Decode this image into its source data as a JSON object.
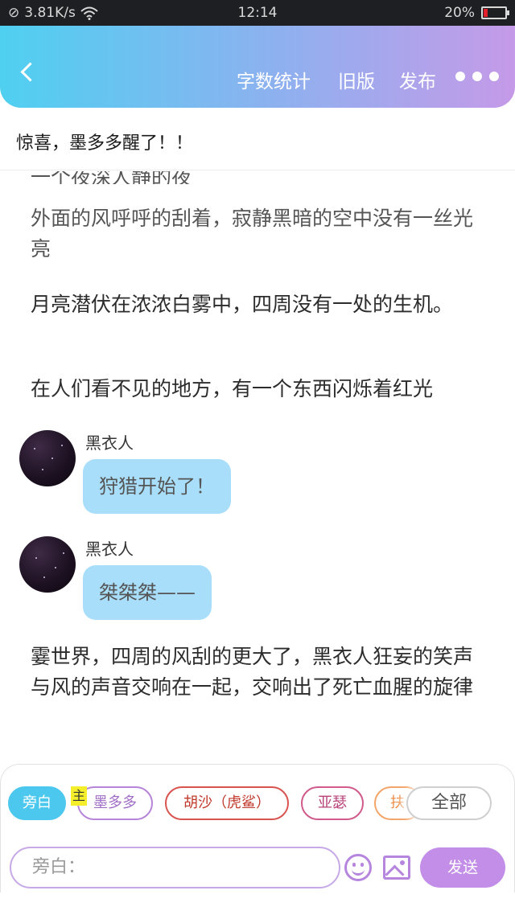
{
  "status_bar": {
    "speed": "3.81K/s",
    "time": "12:14",
    "battery_text": "20%",
    "battery_level": 0.2,
    "battery_color": "#e0202a"
  },
  "header": {
    "back_icon": "chevron-left-icon",
    "actions": {
      "word_count": "字数统计",
      "old_version": "旧版",
      "publish": "发布"
    },
    "more_icon": "more-dots-icon",
    "gradient": [
      "#4fd0f1",
      "#c59ae8"
    ]
  },
  "chapter": {
    "title": "惊喜，墨多多醒了！！"
  },
  "story": {
    "fragment": "一个夜深人静的夜",
    "p1": "外面的风呼呼的刮着，寂静黑暗的空中没有一丝光亮",
    "p2": "月亮潜伏在浓浓白雾中，四周没有一处的生机。",
    "p3": "在人们看不见的地方，有一个东西闪烁着红光",
    "dialogues": [
      {
        "speaker": "黑衣人",
        "text": "狩猎开始了！"
      },
      {
        "speaker": "黑衣人",
        "text": "桀桀桀——"
      }
    ],
    "p4": "霎世界，四周的风刮的更大了，黑衣人狂妄的笑声与风的声音交响在一起，交响出了死亡血腥的旋律"
  },
  "composer": {
    "roles": {
      "narrator": "旁白",
      "moduo": "墨多多",
      "husha": "胡沙（虎鲨）",
      "yase": "亚瑟",
      "fu": "扶",
      "all": "全部"
    },
    "main_tag": "主",
    "input_placeholder": "旁白：",
    "emoji_icon": "emoji-icon",
    "image_icon": "image-icon",
    "send_label": "发送",
    "accent": "#c28ee8"
  }
}
